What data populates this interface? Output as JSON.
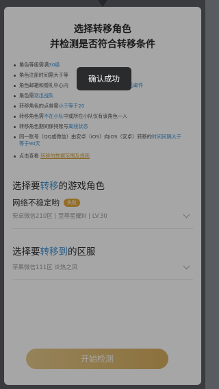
{
  "dialog": {
    "title_line1": "选择转移角色",
    "title_line2": "并检测是否符合转移条件"
  },
  "rules": [
    {
      "text_a": "角色等级需满",
      "hl": "30级",
      "text_b": ""
    },
    {
      "text_a": "角色注册时间需大于等",
      "hl": "",
      "text_b": ""
    },
    {
      "text_a": "角色邮箱和赠礼中心内",
      "hl": "的邮件",
      "text_b": ""
    },
    {
      "text_a": "角色需",
      "hl": "退出战队",
      "text_b": ""
    },
    {
      "text_a": "转移角色的点券需",
      "hl": "小于等于20",
      "text_b": ""
    },
    {
      "text_a": "转移角色需",
      "hl": "不在小队",
      "text_b": "中或所在小队仅有该角色一人"
    },
    {
      "text_a": "转移角色期间保持账号",
      "hl": "离线状态",
      "text_b": ""
    },
    {
      "text_a": "同一账号（QQ或微信）由安卓（iOS）向iOS（安卓）转移的",
      "hl": "时间间隔大于等于90天",
      "text_b": ""
    }
  ],
  "view_link": {
    "prefix": "点击查看",
    "link": "转移的数据范围及规则"
  },
  "role_section": {
    "title_a": "选择要",
    "title_accent": "转移",
    "title_b": "的游戏角色",
    "role_name": "网络不稳定哟",
    "badge": "失败",
    "role_info": "安卓微信210区 | 至尊星耀III | LV.30"
  },
  "server_section": {
    "title_a": "选择要",
    "title_accent": "转移到",
    "title_b": "的区服",
    "server_info": "苹果微信111区 炎热之风"
  },
  "start_button": "开始检测",
  "toast": "确认成功"
}
